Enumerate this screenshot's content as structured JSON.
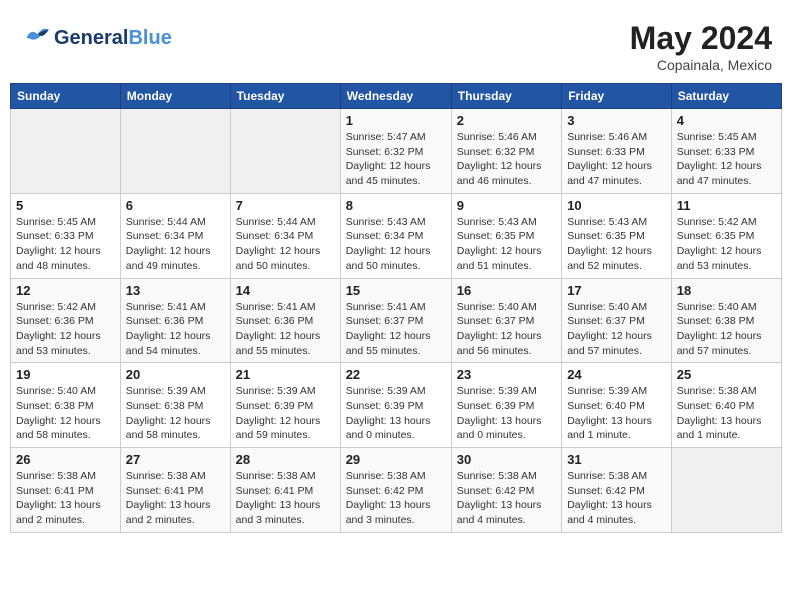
{
  "header": {
    "logo_general": "General",
    "logo_blue": "Blue",
    "month": "May 2024",
    "location": "Copainala, Mexico"
  },
  "weekdays": [
    "Sunday",
    "Monday",
    "Tuesday",
    "Wednesday",
    "Thursday",
    "Friday",
    "Saturday"
  ],
  "weeks": [
    [
      {
        "day": "",
        "empty": true
      },
      {
        "day": "",
        "empty": true
      },
      {
        "day": "",
        "empty": true
      },
      {
        "day": "1",
        "sunrise": "5:47 AM",
        "sunset": "6:32 PM",
        "daylight": "12 hours and 45 minutes."
      },
      {
        "day": "2",
        "sunrise": "5:46 AM",
        "sunset": "6:32 PM",
        "daylight": "12 hours and 46 minutes."
      },
      {
        "day": "3",
        "sunrise": "5:46 AM",
        "sunset": "6:33 PM",
        "daylight": "12 hours and 47 minutes."
      },
      {
        "day": "4",
        "sunrise": "5:45 AM",
        "sunset": "6:33 PM",
        "daylight": "12 hours and 47 minutes."
      }
    ],
    [
      {
        "day": "5",
        "sunrise": "5:45 AM",
        "sunset": "6:33 PM",
        "daylight": "12 hours and 48 minutes."
      },
      {
        "day": "6",
        "sunrise": "5:44 AM",
        "sunset": "6:34 PM",
        "daylight": "12 hours and 49 minutes."
      },
      {
        "day": "7",
        "sunrise": "5:44 AM",
        "sunset": "6:34 PM",
        "daylight": "12 hours and 50 minutes."
      },
      {
        "day": "8",
        "sunrise": "5:43 AM",
        "sunset": "6:34 PM",
        "daylight": "12 hours and 50 minutes."
      },
      {
        "day": "9",
        "sunrise": "5:43 AM",
        "sunset": "6:35 PM",
        "daylight": "12 hours and 51 minutes."
      },
      {
        "day": "10",
        "sunrise": "5:43 AM",
        "sunset": "6:35 PM",
        "daylight": "12 hours and 52 minutes."
      },
      {
        "day": "11",
        "sunrise": "5:42 AM",
        "sunset": "6:35 PM",
        "daylight": "12 hours and 53 minutes."
      }
    ],
    [
      {
        "day": "12",
        "sunrise": "5:42 AM",
        "sunset": "6:36 PM",
        "daylight": "12 hours and 53 minutes."
      },
      {
        "day": "13",
        "sunrise": "5:41 AM",
        "sunset": "6:36 PM",
        "daylight": "12 hours and 54 minutes."
      },
      {
        "day": "14",
        "sunrise": "5:41 AM",
        "sunset": "6:36 PM",
        "daylight": "12 hours and 55 minutes."
      },
      {
        "day": "15",
        "sunrise": "5:41 AM",
        "sunset": "6:37 PM",
        "daylight": "12 hours and 55 minutes."
      },
      {
        "day": "16",
        "sunrise": "5:40 AM",
        "sunset": "6:37 PM",
        "daylight": "12 hours and 56 minutes."
      },
      {
        "day": "17",
        "sunrise": "5:40 AM",
        "sunset": "6:37 PM",
        "daylight": "12 hours and 57 minutes."
      },
      {
        "day": "18",
        "sunrise": "5:40 AM",
        "sunset": "6:38 PM",
        "daylight": "12 hours and 57 minutes."
      }
    ],
    [
      {
        "day": "19",
        "sunrise": "5:40 AM",
        "sunset": "6:38 PM",
        "daylight": "12 hours and 58 minutes."
      },
      {
        "day": "20",
        "sunrise": "5:39 AM",
        "sunset": "6:38 PM",
        "daylight": "12 hours and 58 minutes."
      },
      {
        "day": "21",
        "sunrise": "5:39 AM",
        "sunset": "6:39 PM",
        "daylight": "12 hours and 59 minutes."
      },
      {
        "day": "22",
        "sunrise": "5:39 AM",
        "sunset": "6:39 PM",
        "daylight": "13 hours and 0 minutes."
      },
      {
        "day": "23",
        "sunrise": "5:39 AM",
        "sunset": "6:39 PM",
        "daylight": "13 hours and 0 minutes."
      },
      {
        "day": "24",
        "sunrise": "5:39 AM",
        "sunset": "6:40 PM",
        "daylight": "13 hours and 1 minute."
      },
      {
        "day": "25",
        "sunrise": "5:38 AM",
        "sunset": "6:40 PM",
        "daylight": "13 hours and 1 minute."
      }
    ],
    [
      {
        "day": "26",
        "sunrise": "5:38 AM",
        "sunset": "6:41 PM",
        "daylight": "13 hours and 2 minutes."
      },
      {
        "day": "27",
        "sunrise": "5:38 AM",
        "sunset": "6:41 PM",
        "daylight": "13 hours and 2 minutes."
      },
      {
        "day": "28",
        "sunrise": "5:38 AM",
        "sunset": "6:41 PM",
        "daylight": "13 hours and 3 minutes."
      },
      {
        "day": "29",
        "sunrise": "5:38 AM",
        "sunset": "6:42 PM",
        "daylight": "13 hours and 3 minutes."
      },
      {
        "day": "30",
        "sunrise": "5:38 AM",
        "sunset": "6:42 PM",
        "daylight": "13 hours and 4 minutes."
      },
      {
        "day": "31",
        "sunrise": "5:38 AM",
        "sunset": "6:42 PM",
        "daylight": "13 hours and 4 minutes."
      },
      {
        "day": "",
        "empty": true
      }
    ]
  ],
  "labels": {
    "sunrise": "Sunrise:",
    "sunset": "Sunset:",
    "daylight": "Daylight:"
  }
}
